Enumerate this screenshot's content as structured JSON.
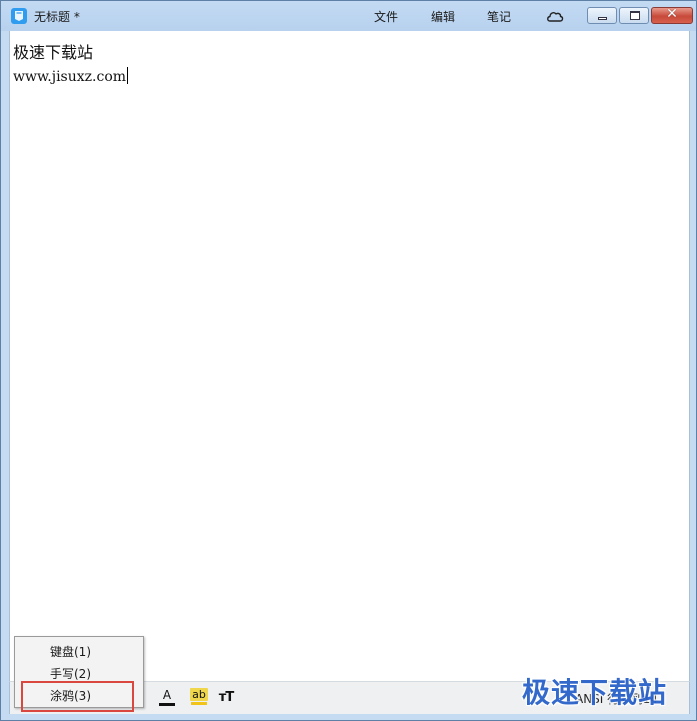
{
  "titlebar": {
    "title": "无标题 *",
    "menu": {
      "file": "文件",
      "edit": "编辑",
      "note": "笔记"
    },
    "close_glyph": "✕"
  },
  "editor": {
    "line1": "极速下载站",
    "line2": "www.jisuxz.com"
  },
  "toolbar": {
    "font_color_glyph": "A",
    "highlight_glyph": "ab",
    "font_size_glyph": "тT",
    "status_text": "ANSI 行1 列14"
  },
  "popup_menu": {
    "items": [
      {
        "label": "键盘(1)"
      },
      {
        "label": "手写(2)"
      },
      {
        "label": "涂鸦(3)"
      }
    ]
  },
  "watermark": {
    "text": "极速下载站"
  },
  "colors": {
    "accent_blue": "#2f9cf0",
    "highlight_red": "#d9473f",
    "watermark_blue": "#2a62c9"
  }
}
